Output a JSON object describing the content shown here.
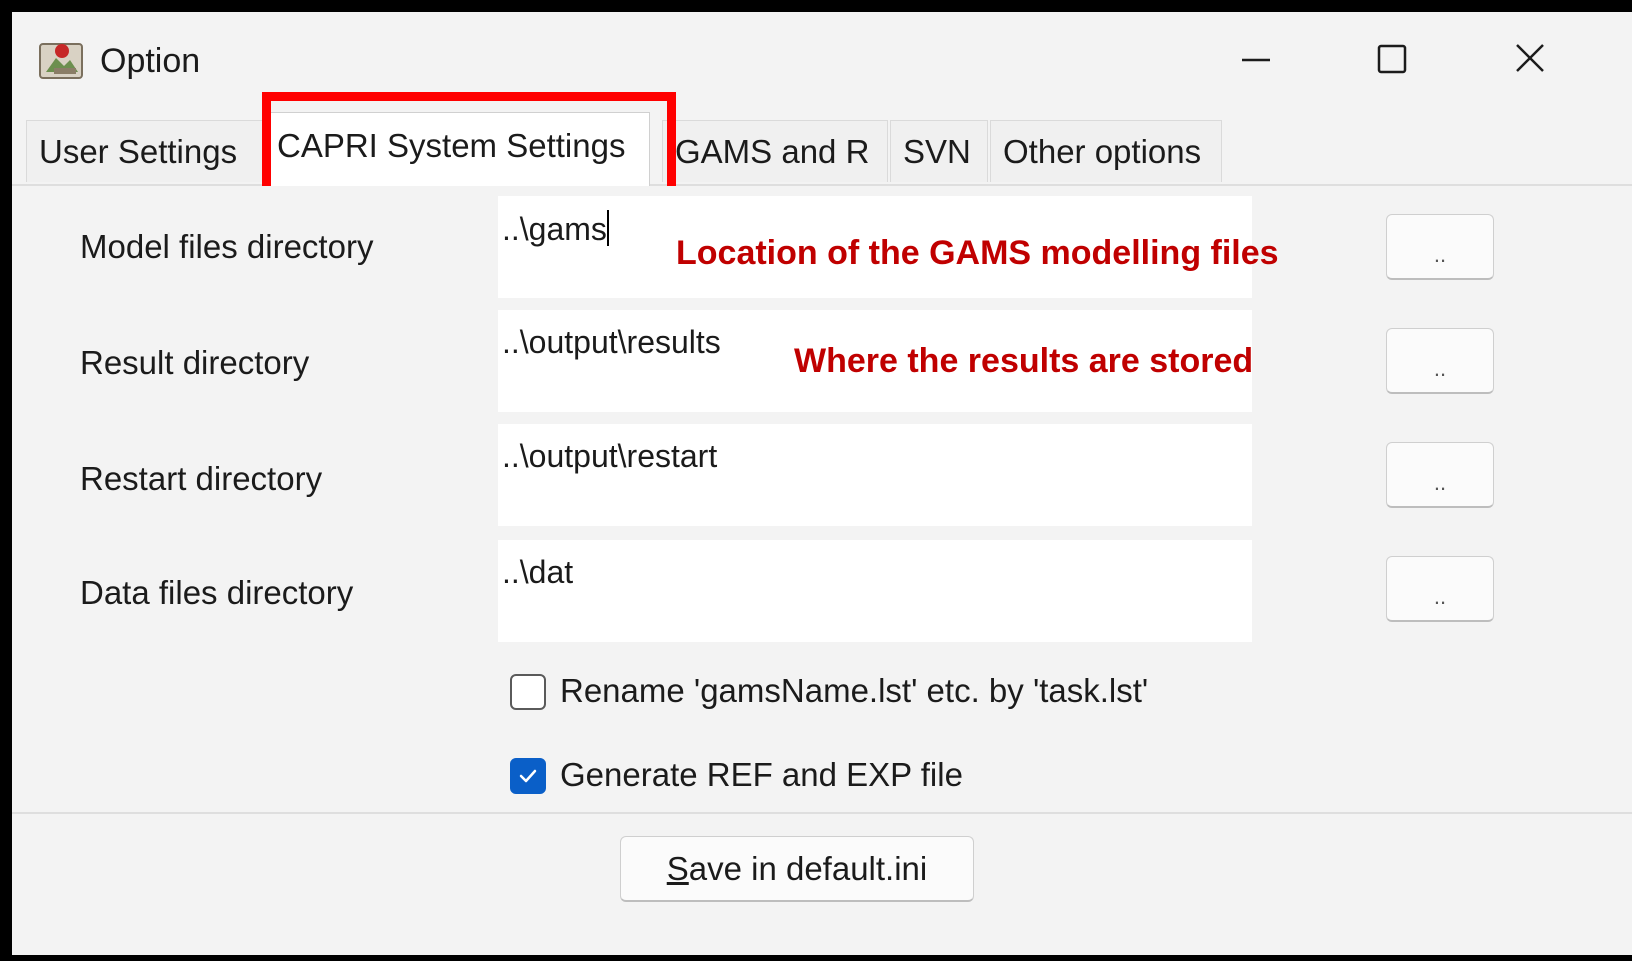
{
  "window": {
    "title": "Option",
    "icon": "java-app-icon",
    "controls": [
      "minimize-icon",
      "maximize-icon",
      "close-icon"
    ]
  },
  "tabs": [
    {
      "label": "User Settings",
      "active": false
    },
    {
      "label": "CAPRI System Settings",
      "active": true
    },
    {
      "label": "GAMS and R",
      "active": false
    },
    {
      "label": "SVN",
      "active": false
    },
    {
      "label": "Other options",
      "active": false
    }
  ],
  "fields": [
    {
      "label": "Model files directory",
      "value": "..\\gams",
      "browse_label": ".."
    },
    {
      "label": "Result directory",
      "value": "..\\output\\results",
      "browse_label": ".."
    },
    {
      "label": "Restart directory",
      "value": "..\\output\\restart",
      "browse_label": ".."
    },
    {
      "label": "Data files directory",
      "value": "..\\dat",
      "browse_label": ".."
    }
  ],
  "annotations": {
    "model_files": "Location of the GAMS modelling files",
    "results": "Where the results are stored",
    "highlight_color": "#ff0000",
    "text_color": "#c00000"
  },
  "options": [
    {
      "label": "Rename 'gamsName.lst' etc. by 'task.lst'",
      "checked": false
    },
    {
      "label": "Generate REF and EXP file",
      "checked": true
    }
  ],
  "footer": {
    "save_mnemonic": "S",
    "save_rest": "ave in default.ini"
  },
  "colors": {
    "checkbox_accent": "#0a5fc8"
  }
}
